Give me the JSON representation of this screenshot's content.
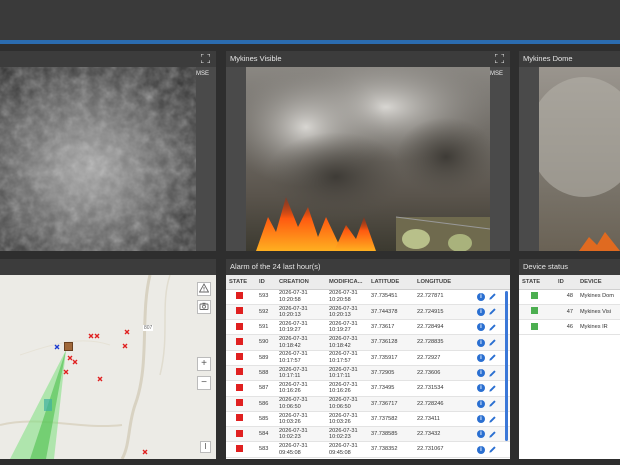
{
  "panels": {
    "visible_title": "Mykines Visible",
    "dome_title": "Mykines Dome",
    "alarm_title": "Alarm of the 24 last hour(s)",
    "device_title": "Device status",
    "mse_label": "MSE"
  },
  "alarm_table": {
    "headers": [
      "STATE",
      "ID",
      "CREATION",
      "MODIFICA...",
      "LATITUDE",
      "LONGITUDE"
    ],
    "rows": [
      {
        "id": "593",
        "creation": "2026-07-31 10:20:58",
        "modified": "2026-07-31 10:20:58",
        "lat": "37.735451",
        "lon": "22.727871"
      },
      {
        "id": "592",
        "creation": "2026-07-31 10:20:13",
        "modified": "2026-07-31 10:20:13",
        "lat": "37.744378",
        "lon": "22.724915"
      },
      {
        "id": "591",
        "creation": "2026-07-31 10:19:27",
        "modified": "2026-07-31 10:19:27",
        "lat": "37.73617",
        "lon": "22.728494"
      },
      {
        "id": "590",
        "creation": "2026-07-31 10:18:42",
        "modified": "2026-07-31 10:18:42",
        "lat": "37.736128",
        "lon": "22.728835"
      },
      {
        "id": "589",
        "creation": "2026-07-31 10:17:57",
        "modified": "2026-07-31 10:17:57",
        "lat": "37.735917",
        "lon": "22.72927"
      },
      {
        "id": "588",
        "creation": "2026-07-31 10:17:11",
        "modified": "2026-07-31 10:17:11",
        "lat": "37.72905",
        "lon": "22.73606"
      },
      {
        "id": "587",
        "creation": "2026-07-31 10:16:26",
        "modified": "2026-07-31 10:16:26",
        "lat": "37.73495",
        "lon": "22.731534"
      },
      {
        "id": "586",
        "creation": "2026-07-31 10:06:50",
        "modified": "2026-07-31 10:06:50",
        "lat": "37.736717",
        "lon": "22.728246"
      },
      {
        "id": "585",
        "creation": "2026-07-31 10:03:26",
        "modified": "2026-07-31 10:03:26",
        "lat": "37.737582",
        "lon": "22.73411"
      },
      {
        "id": "584",
        "creation": "2026-07-31 10:02:23",
        "modified": "2026-07-31 10:02:23",
        "lat": "37.738585",
        "lon": "22.73432"
      },
      {
        "id": "583",
        "creation": "2026-07-31 09:45:08",
        "modified": "2026-07-31 09:45:08",
        "lat": "37.738352",
        "lon": "22.731067"
      }
    ]
  },
  "device_table": {
    "headers": [
      "STATE",
      "ID",
      "DEVICE"
    ],
    "rows": [
      {
        "id": "48",
        "device": "Mykines Dom"
      },
      {
        "id": "47",
        "device": "Mykines Visi"
      },
      {
        "id": "46",
        "device": "Mykines IR"
      }
    ]
  },
  "map": {
    "road_label": "807",
    "zoom_in": "+",
    "zoom_out": "−",
    "alert_icon": "warning-icon",
    "camera_icon": "camera-icon",
    "bottom_button": "I"
  },
  "colors": {
    "accent": "#2b6cb0",
    "alarm_state": "#e02020",
    "ok_state": "#4caf50",
    "info": "#2a6fd1"
  }
}
